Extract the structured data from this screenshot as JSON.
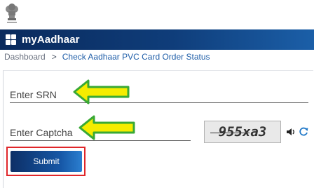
{
  "app": {
    "brand": "myAadhaar"
  },
  "breadcrumb": {
    "home": "Dashboard",
    "separator": ">",
    "current": "Check Aadhaar PVC Card Order Status"
  },
  "form": {
    "srn_placeholder": "Enter SRN",
    "captcha_placeholder": "Enter Captcha",
    "captcha_text": "955xa3",
    "submit_label": "Submit"
  },
  "colors": {
    "header": "#0f3d7a",
    "link": "#1f5ea8",
    "highlight": "#e0262a",
    "arrow_fill": "#f5ec00",
    "arrow_stroke": "#39a935"
  }
}
